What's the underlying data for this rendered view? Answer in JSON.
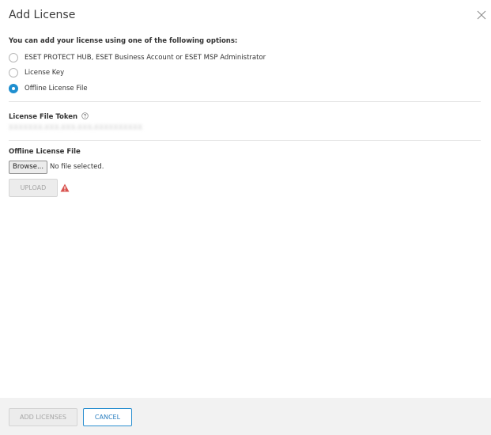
{
  "dialog": {
    "title": "Add License"
  },
  "options": {
    "intro": "You can add your license using one of the following options:",
    "items": [
      {
        "label": "ESET PROTECT HUB, ESET Business Account or ESET MSP Administrator",
        "selected": false
      },
      {
        "label": "License Key",
        "selected": false
      },
      {
        "label": "Offline License File",
        "selected": true
      }
    ]
  },
  "token": {
    "label": "License File Token",
    "value": "XXXXXXX-XXX-XXX-XXX-XXXXXXXXXX"
  },
  "offline_file": {
    "label": "Offline License File",
    "browse_label": "Browse...",
    "status": "No file selected.",
    "upload_label": "UPLOAD"
  },
  "footer": {
    "add_label": "ADD LICENSES",
    "cancel_label": "CANCEL"
  },
  "colors": {
    "accent": "#1f8fd0",
    "warning": "#d9534f",
    "footer_bg": "#f2f2f2"
  }
}
